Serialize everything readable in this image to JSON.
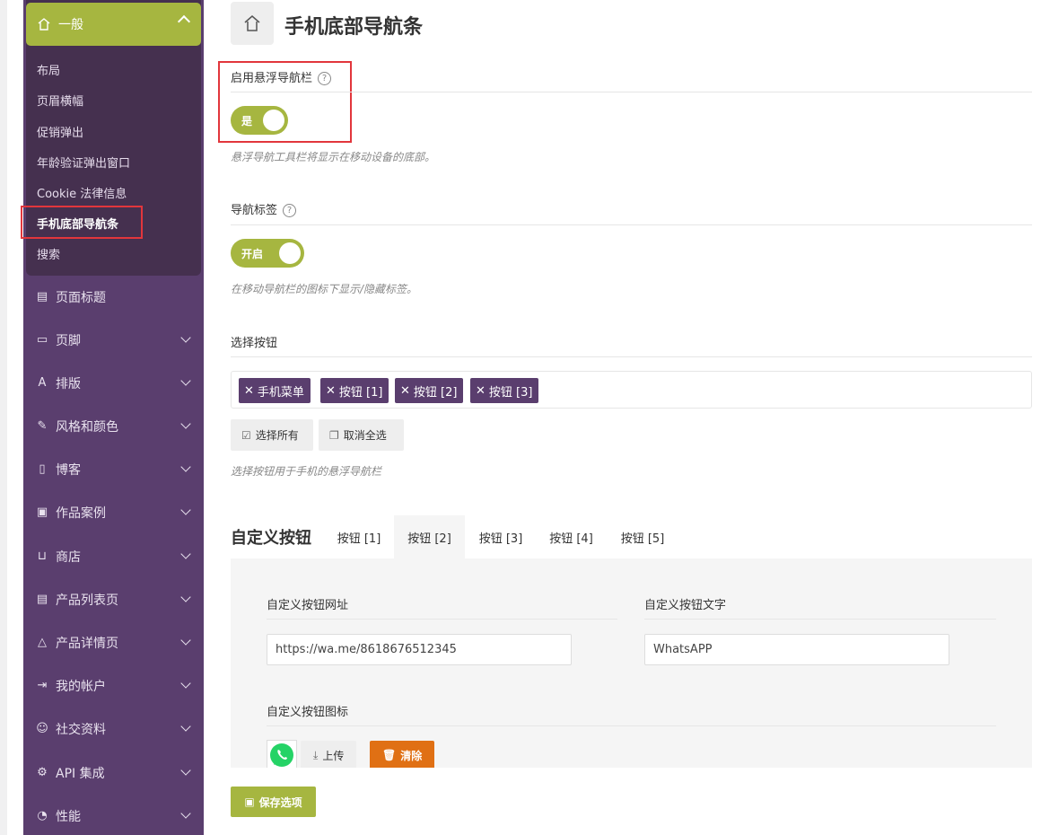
{
  "sidebar": {
    "group": {
      "label": "一般"
    },
    "sub_items": [
      "布局",
      "页眉横幅",
      "促销弹出",
      "年龄验证弹出窗口",
      "Cookie 法律信息",
      "手机底部导航条",
      "搜索"
    ],
    "nav_items": [
      "页面标题",
      "页脚",
      "排版",
      "风格和颜色",
      "博客",
      "作品案例",
      "商店",
      "产品列表页",
      "产品详情页",
      "我的帐户",
      "社交资料",
      "API 集成",
      "性能"
    ]
  },
  "page": {
    "title": "手机底部导航条"
  },
  "floating_bar": {
    "label": "启用悬浮导航栏",
    "toggle": "是",
    "help": "悬浮导航工具栏将显示在移动设备的底部。"
  },
  "nav_labels": {
    "label": "导航标签",
    "toggle": "开启",
    "help": "在移动导航栏的图标下显示/隐藏标签。"
  },
  "select_buttons": {
    "label": "选择按钮",
    "tags": [
      "手机菜单",
      "按钮 [1]",
      "按钮 [2]",
      "按钮 [3]"
    ],
    "select_all": "选择所有",
    "deselect_all": "取消全选",
    "help": "选择按钮用于手机的悬浮导航栏"
  },
  "custom_buttons": {
    "heading": "自定义按钮",
    "tabs": [
      "按钮 [1]",
      "按钮 [2]",
      "按钮 [3]",
      "按钮 [4]",
      "按钮 [5]"
    ],
    "active_tab": "按钮 [2]",
    "url_label": "自定义按钮网址",
    "url_value": "https://wa.me/8618676512345",
    "text_label": "自定义按钮文字",
    "text_value": "WhatsAPP",
    "icon_label": "自定义按钮图标",
    "upload": "上传",
    "clear": "清除"
  },
  "save": "保存选项",
  "colors": {
    "sidebar": "#5a3e6e",
    "accent": "#a6b640",
    "danger": "#e07014",
    "highlight": "#e2363c"
  }
}
